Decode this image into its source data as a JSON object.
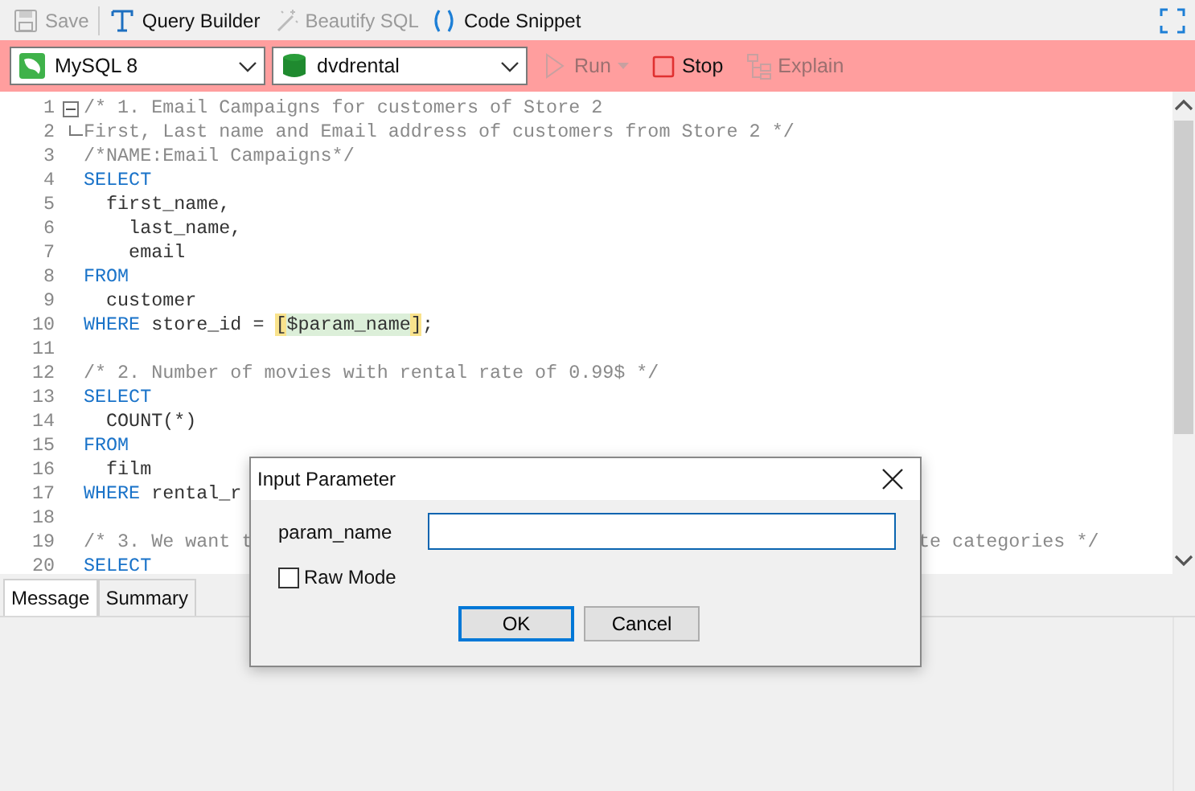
{
  "toolbar": [
    {
      "kind": "save",
      "label": "Save",
      "disabled": true
    },
    {
      "kind": "builder",
      "label": "Query Builder",
      "disabled": false
    },
    {
      "kind": "beautify",
      "label": "Beautify SQL",
      "disabled": true
    },
    {
      "kind": "snippet",
      "label": "Code Snippet",
      "disabled": false
    }
  ],
  "connection_bar": {
    "connection": "MySQL 8",
    "database": "dvdrental",
    "actions": [
      {
        "kind": "run",
        "label": "Run",
        "disabled": true
      },
      {
        "kind": "stop",
        "label": "Stop",
        "disabled": false
      },
      {
        "kind": "explain",
        "label": "Explain",
        "disabled": true
      }
    ]
  },
  "editor": {
    "lines": [
      {
        "number": "1",
        "fold_start": true,
        "tokens": [
          {
            "kind": "comment",
            "text": "/* 1. Email Campaigns for customers of Store 2"
          }
        ]
      },
      {
        "number": "2",
        "fold_end": true,
        "tokens": [
          {
            "kind": "comment",
            "text": "First, Last name and Email address of customers from Store 2 */"
          }
        ]
      },
      {
        "number": "3",
        "tokens": [
          {
            "kind": "comment",
            "text": "/*NAME:Email Campaigns*/"
          }
        ]
      },
      {
        "number": "4",
        "tokens": [
          {
            "kind": "keyword",
            "text": "SELECT"
          }
        ]
      },
      {
        "number": "5",
        "tokens": [
          {
            "kind": "plain",
            "text": "  first_name,"
          }
        ]
      },
      {
        "number": "6",
        "tokens": [
          {
            "kind": "plain",
            "text": "    last_name,"
          }
        ]
      },
      {
        "number": "7",
        "tokens": [
          {
            "kind": "plain",
            "text": "    email"
          }
        ]
      },
      {
        "number": "8",
        "tokens": [
          {
            "kind": "keyword",
            "text": "FROM"
          }
        ]
      },
      {
        "number": "9",
        "tokens": [
          {
            "kind": "plain",
            "text": "  customer"
          }
        ]
      },
      {
        "number": "10",
        "tokens": [
          {
            "kind": "keyword",
            "text": "WHERE"
          },
          {
            "kind": "plain",
            "text": " store_id = "
          },
          {
            "kind": "bracket",
            "text": "["
          },
          {
            "kind": "param",
            "text": "$param_name"
          },
          {
            "kind": "bracket",
            "text": "]"
          },
          {
            "kind": "plain",
            "text": ";"
          }
        ]
      },
      {
        "number": "11"
      },
      {
        "number": "12",
        "tokens": [
          {
            "kind": "comment",
            "text": "/* 2. Number of movies with rental rate of 0.99$ */"
          }
        ]
      },
      {
        "number": "13",
        "tokens": [
          {
            "kind": "keyword",
            "text": "SELECT"
          }
        ]
      },
      {
        "number": "14",
        "tokens": [
          {
            "kind": "plain",
            "text": "  COUNT(*)"
          }
        ]
      },
      {
        "number": "15",
        "tokens": [
          {
            "kind": "keyword",
            "text": "FROM"
          }
        ]
      },
      {
        "number": "16",
        "tokens": [
          {
            "kind": "plain",
            "text": "  film"
          }
        ]
      },
      {
        "number": "17",
        "tokens": [
          {
            "kind": "keyword",
            "text": "WHERE"
          },
          {
            "kind": "plain",
            "text": " rental_r"
          }
        ]
      },
      {
        "number": "18"
      },
      {
        "number": "19",
        "tokens": [
          {
            "kind": "comment",
            "text": "/* 3. We want t"
          },
          {
            "kind": "comment_after_gap",
            "text": "te categories */"
          }
        ]
      },
      {
        "number": "20",
        "tokens": [
          {
            "kind": "keyword",
            "text": "SELECT"
          }
        ]
      }
    ]
  },
  "bottom_tabs": [
    {
      "label": "Message",
      "selected": true
    },
    {
      "label": "Summary",
      "selected": false
    }
  ],
  "dialog": {
    "title": "Input Parameter",
    "field_label": "param_name",
    "checkbox": {
      "label": "Raw Mode",
      "checked": false
    },
    "buttons": [
      {
        "label": "OK",
        "default": true
      },
      {
        "label": "Cancel",
        "default": false
      }
    ]
  }
}
